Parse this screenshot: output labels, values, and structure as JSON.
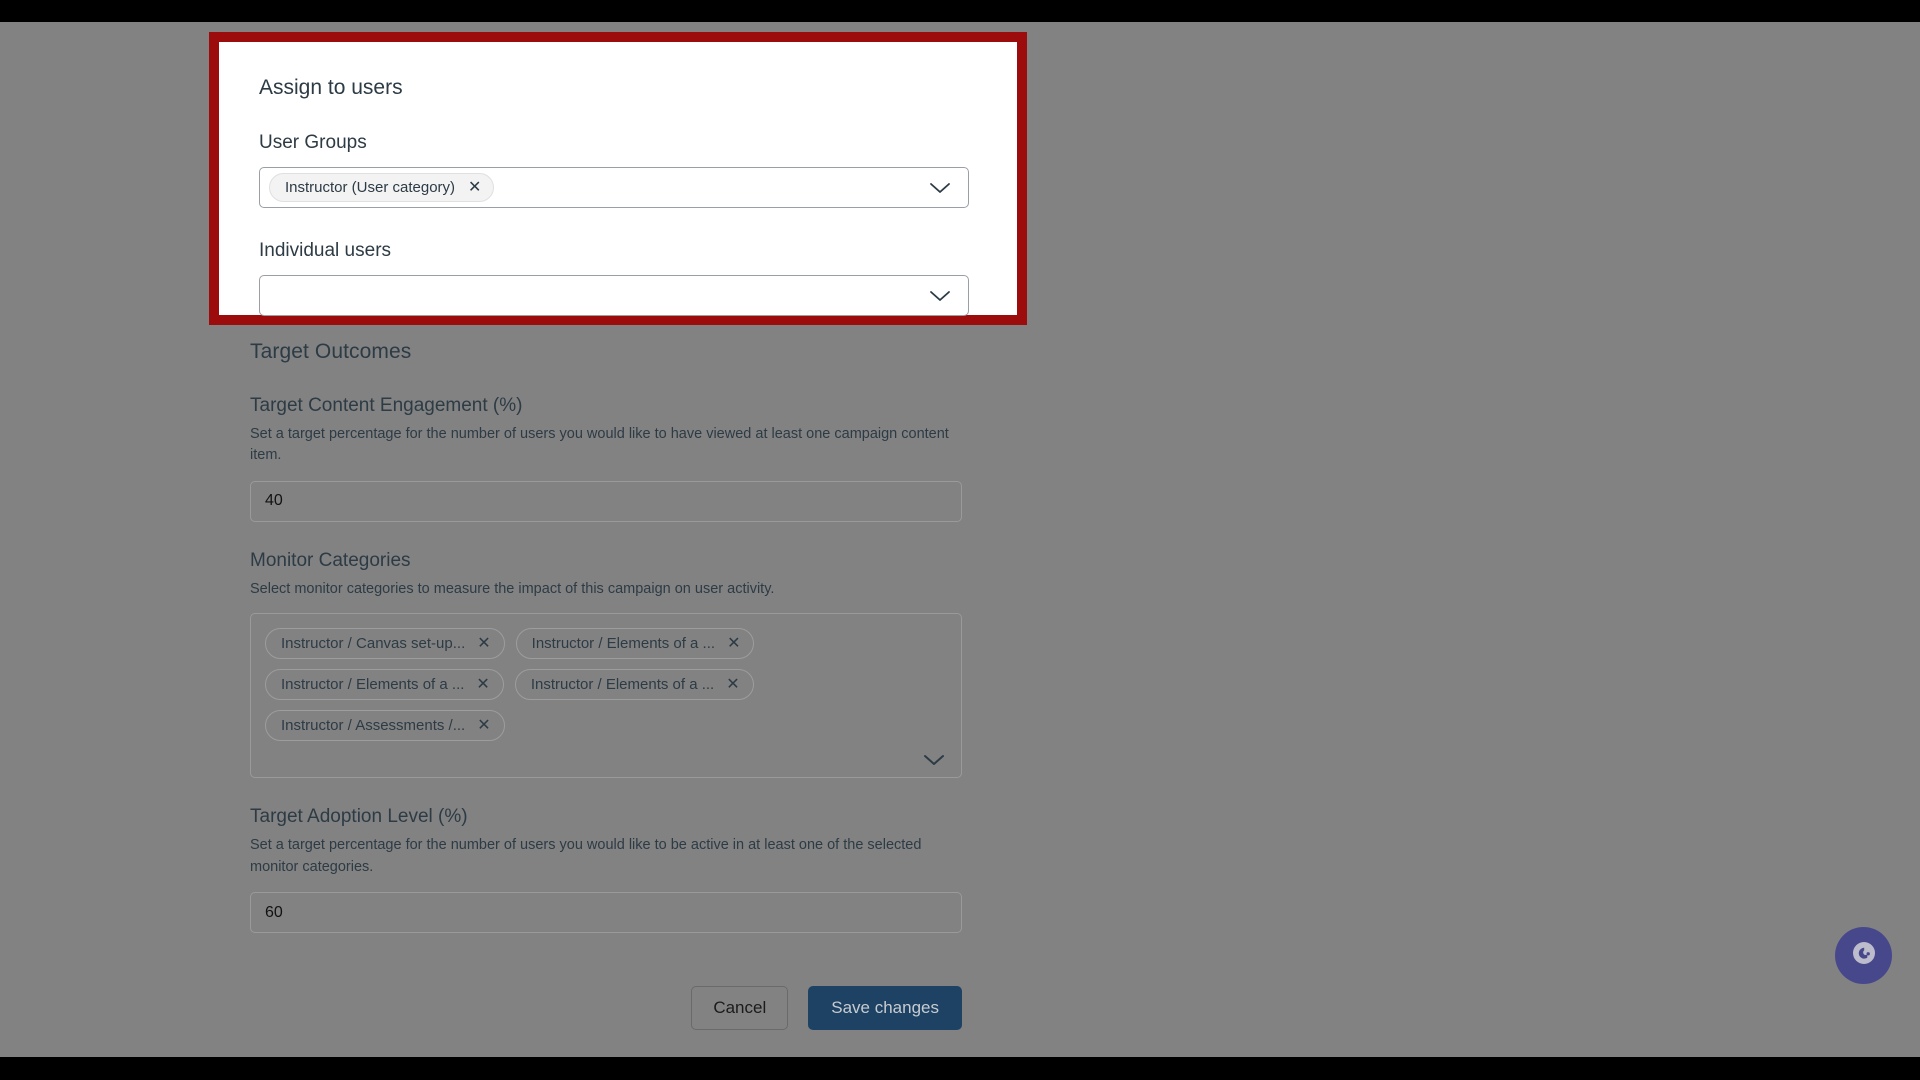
{
  "theme": {
    "highlight_border": "#9d0c0c",
    "primary_button_bg": "#1e4264",
    "overlay_bg": "#828282",
    "chat_bg": "#3b3b8f",
    "text": "#2d3b45"
  },
  "highlight_panel": {
    "title": "Assign to users",
    "user_groups": {
      "label": "User Groups",
      "selected": [
        {
          "text": "Instructor (User category)",
          "remove": "✕"
        }
      ],
      "chevron_icon": "chevron-down-icon"
    },
    "individual_users": {
      "label": "Individual users",
      "value": "",
      "placeholder": "",
      "chevron_icon": "chevron-down-icon"
    }
  },
  "form": {
    "section_title": "Target Outcomes",
    "content_engagement": {
      "label": "Target Content Engagement (%)",
      "help": "Set a target percentage for the number of users you would like to have viewed at least one campaign content item.",
      "value": "40"
    },
    "monitor_categories": {
      "label": "Monitor Categories",
      "help": "Select monitor categories to measure the impact of this campaign on user activity.",
      "chevron_icon": "chevron-down-icon",
      "tags": [
        {
          "text": "Instructor / Canvas set-up...",
          "remove": "✕"
        },
        {
          "text": "Instructor / Elements of a ...",
          "remove": "✕"
        },
        {
          "text": "Instructor / Elements of a ...",
          "remove": "✕"
        },
        {
          "text": "Instructor / Elements of a ...",
          "remove": "✕"
        },
        {
          "text": "Instructor / Assessments /...",
          "remove": "✕"
        }
      ]
    },
    "adoption_level": {
      "label": "Target Adoption Level (%)",
      "help": "Set a target percentage for the number of users you would like to be active in at least one of the selected monitor categories.",
      "value": "60"
    }
  },
  "actions": {
    "cancel_label": "Cancel",
    "save_label": "Save changes"
  },
  "chat": {
    "icon": "chat-bubble-icon"
  }
}
